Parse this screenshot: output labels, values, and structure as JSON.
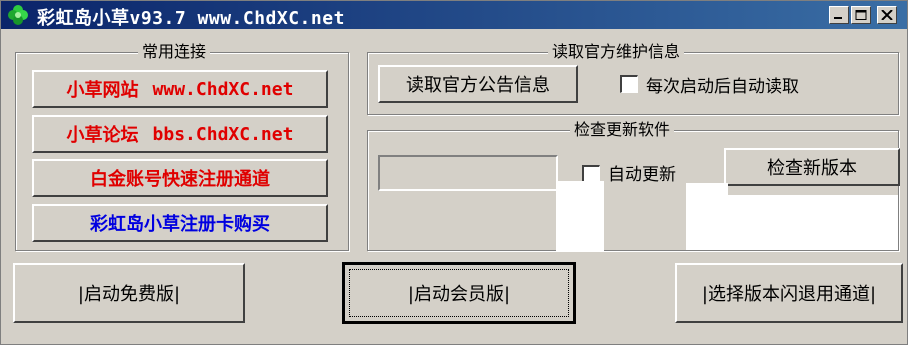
{
  "window": {
    "title": "彩虹岛小草v93.7 www.ChdXC.net",
    "controls": {
      "minimize": "minimize-icon",
      "maximize": "maximize-icon",
      "close": "close-icon"
    }
  },
  "links_group": {
    "title": "常用连接",
    "items": [
      {
        "label_cn": "小草网站",
        "label_url": "www.ChdXC.net"
      },
      {
        "label_cn": "小草论坛",
        "label_url": "bbs.ChdXC.net"
      },
      {
        "label_cn": "白金账号快速注册通道"
      },
      {
        "label_cn": "彩虹岛小草注册卡购买"
      }
    ]
  },
  "notice_group": {
    "title": "读取官方维护信息",
    "read_button": "读取官方公告信息",
    "auto_read_label": "每次启动后自动读取"
  },
  "update_group": {
    "title": "检查更新软件",
    "auto_update_label": "自动更新",
    "check_button": "检查新版本"
  },
  "bottom": {
    "free_button": "|启动免费版|",
    "member_button": "|启动会员版|",
    "fallback_button": "|选择版本闪退用通道|"
  },
  "colors": {
    "link_red": "#e00000",
    "link_blue": "#0000e0",
    "titlebar": "#0a246a"
  }
}
